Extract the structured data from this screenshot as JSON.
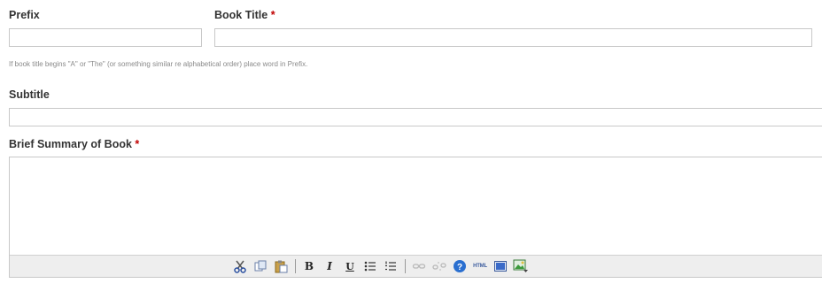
{
  "fields": {
    "prefix": {
      "label": "Prefix",
      "value": ""
    },
    "book_title": {
      "label": "Book Title",
      "required_mark": "*",
      "value": ""
    },
    "hint": "If book title begins \"A\" or \"The\" (or something similar re alphabetical order) place word in Prefix.",
    "subtitle": {
      "label": "Subtitle",
      "value": ""
    },
    "summary": {
      "label": "Brief Summary of Book",
      "required_mark": "*",
      "value": ""
    }
  },
  "toolbar": {
    "buttons": [
      {
        "name": "cut",
        "icon": "scissors-icon"
      },
      {
        "name": "copy",
        "icon": "copy-icon"
      },
      {
        "name": "paste",
        "icon": "paste-icon"
      },
      {
        "name": "bold",
        "glyph": "B"
      },
      {
        "name": "italic",
        "glyph": "I"
      },
      {
        "name": "underline",
        "glyph": "U"
      },
      {
        "name": "bullet-list",
        "icon": "bullet-list-icon"
      },
      {
        "name": "numbered-list",
        "icon": "numbered-list-icon"
      },
      {
        "name": "link",
        "icon": "link-icon",
        "enabled": false
      },
      {
        "name": "unlink",
        "icon": "unlink-icon",
        "enabled": false
      },
      {
        "name": "help",
        "icon": "help-icon"
      },
      {
        "name": "html",
        "glyph": "HTML"
      },
      {
        "name": "fullscreen",
        "icon": "fullscreen-icon"
      },
      {
        "name": "insert-image",
        "icon": "image-icon"
      }
    ],
    "colors": {
      "background": "#eeeeee",
      "help": "#2a6fd0",
      "image": "#3a9a3a"
    }
  }
}
